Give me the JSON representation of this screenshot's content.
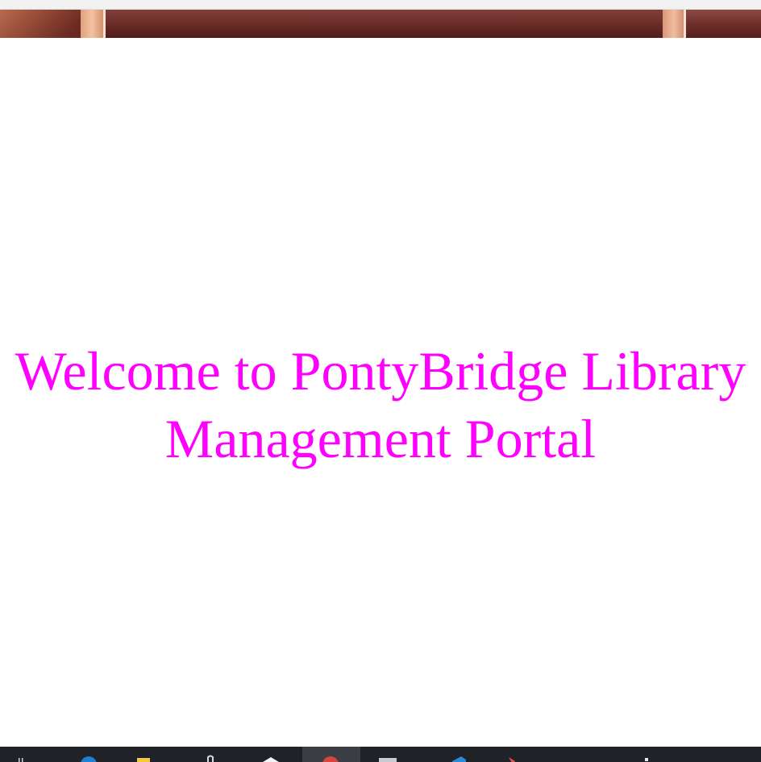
{
  "page": {
    "heading_line1": "Welcome to PontyBridge Library",
    "heading_line2": "Management Portal",
    "heading_color": "#ff00ff"
  },
  "banner": {
    "description_icon": "wood-panel-banner"
  },
  "taskbar": {
    "icons": [
      "task-view-icon",
      "edge-browser-icon",
      "file-explorer-icon",
      "paperclip-icon",
      "mail-icon",
      "chrome-icon",
      "window-icon",
      "vscode-icon",
      "tool-icon",
      "system-icon"
    ]
  }
}
